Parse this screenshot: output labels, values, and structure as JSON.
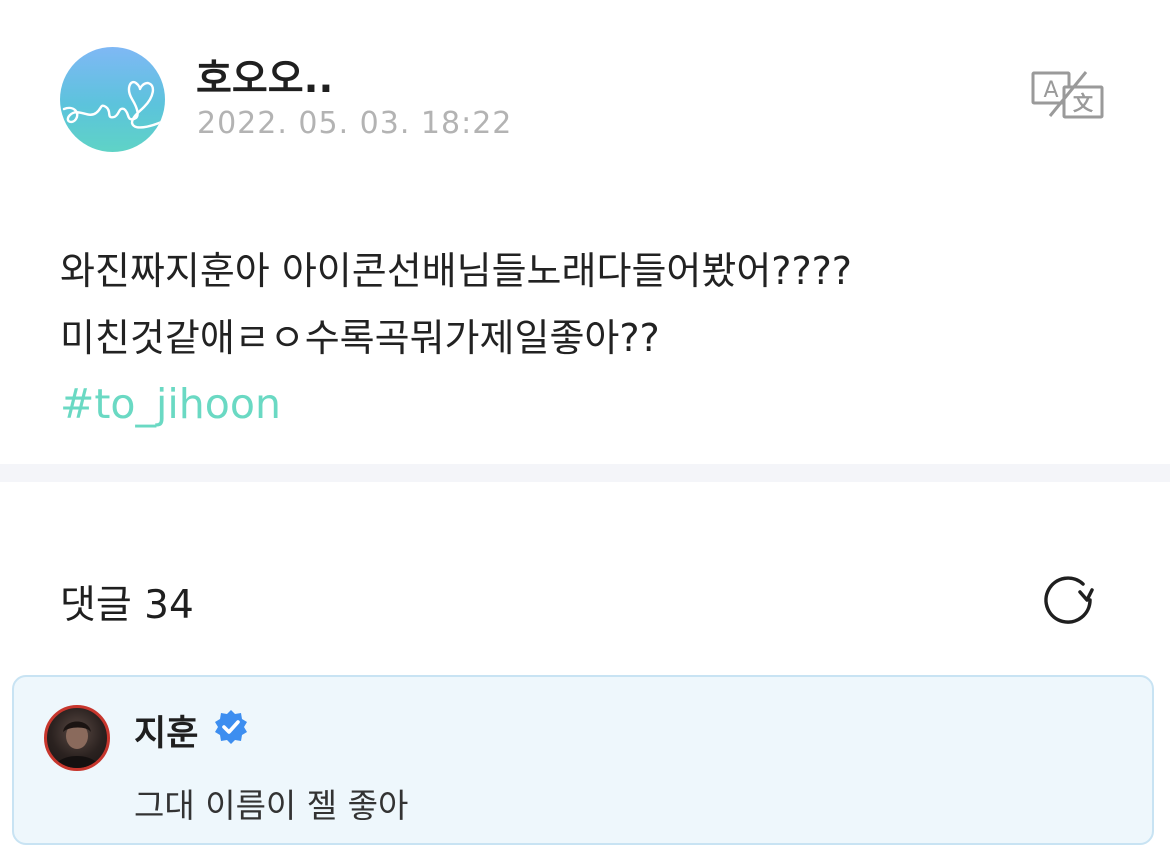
{
  "post": {
    "author": "호오오..",
    "timestamp": "2022. 05. 03. 18:22",
    "avatar_icon": "heart-line-icon",
    "translate_icon": "translate-icon",
    "body_lines": [
      "와진짜지훈아 아이콘선배님들노래다들어봤어????",
      "미친것같애ㄹㅇ수록곡뭐가제일좋아??"
    ],
    "hashtag": "#to_jihoon",
    "hashtag_color": "#6ad9c3"
  },
  "comments": {
    "title": "댓글 34",
    "refresh_icon": "refresh-icon",
    "items": [
      {
        "author": "지훈",
        "verified": true,
        "verified_color": "#3d8ef0",
        "text": "그대 이름이 젤 좋아"
      }
    ]
  }
}
